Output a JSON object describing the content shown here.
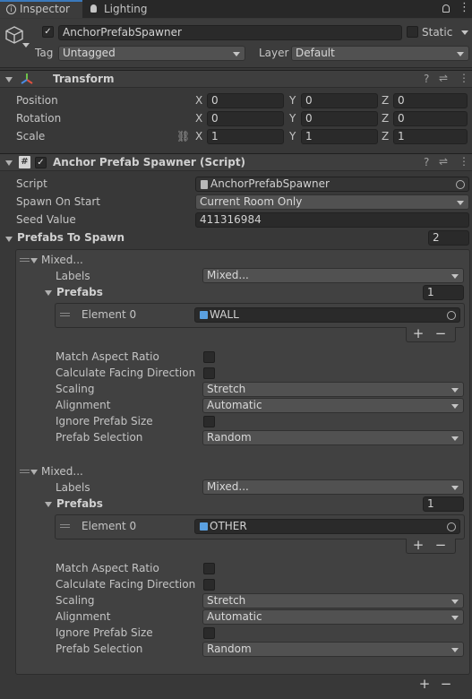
{
  "tabs": {
    "inspector": "Inspector",
    "lighting": "Lighting"
  },
  "object": {
    "name": "AnchorPrefabSpawner",
    "static_label": "Static",
    "tag_label": "Tag",
    "tag_value": "Untagged",
    "layer_label": "Layer",
    "layer_value": "Default"
  },
  "transform": {
    "title": "Transform",
    "rows": [
      {
        "label": "Position",
        "x": "0",
        "y": "0",
        "z": "0"
      },
      {
        "label": "Rotation",
        "x": "0",
        "y": "0",
        "z": "0"
      },
      {
        "label": "Scale",
        "x": "1",
        "y": "1",
        "z": "1"
      }
    ],
    "axis_x": "X",
    "axis_y": "Y",
    "axis_z": "Z"
  },
  "script_comp": {
    "title": "Anchor Prefab Spawner (Script)",
    "script_label": "Script",
    "script_value": "AnchorPrefabSpawner",
    "spawn_label": "Spawn On Start",
    "spawn_value": "Current Room Only",
    "seed_label": "Seed Value",
    "seed_value": "411316984",
    "prefabs_to_spawn_label": "Prefabs To Spawn",
    "prefabs_to_spawn_count": "2"
  },
  "entries": [
    {
      "header": "Mixed...",
      "labels_label": "Labels",
      "labels_value": "Mixed...",
      "prefabs_label": "Prefabs",
      "prefabs_count": "1",
      "element_label": "Element 0",
      "element_value": "WALL",
      "match_label": "Match Aspect Ratio",
      "facing_label": "Calculate Facing Direction",
      "scaling_label": "Scaling",
      "scaling_value": "Stretch",
      "alignment_label": "Alignment",
      "alignment_value": "Automatic",
      "ignore_label": "Ignore Prefab Size",
      "selection_label": "Prefab Selection",
      "selection_value": "Random"
    },
    {
      "header": "Mixed...",
      "labels_label": "Labels",
      "labels_value": "Mixed...",
      "prefabs_label": "Prefabs",
      "prefabs_count": "1",
      "element_label": "Element 0",
      "element_value": "OTHER",
      "match_label": "Match Aspect Ratio",
      "facing_label": "Calculate Facing Direction",
      "scaling_label": "Scaling",
      "scaling_value": "Stretch",
      "alignment_label": "Alignment",
      "alignment_value": "Automatic",
      "ignore_label": "Ignore Prefab Size",
      "selection_label": "Prefab Selection",
      "selection_value": "Random"
    }
  ],
  "buttons": {
    "plus": "+",
    "minus": "−"
  }
}
